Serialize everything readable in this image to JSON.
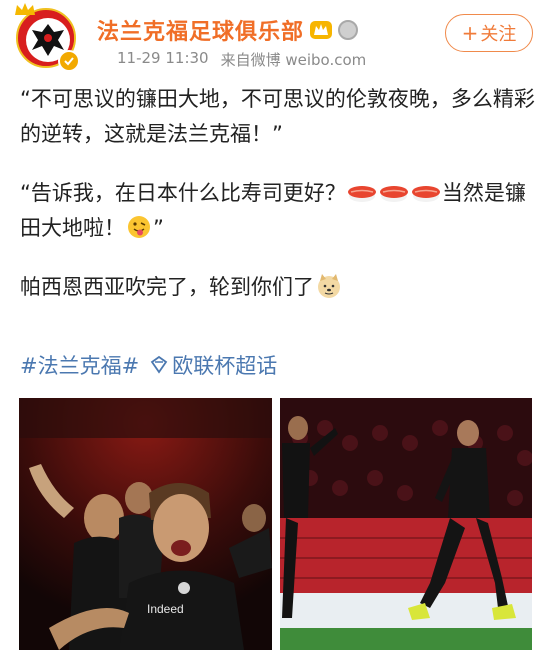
{
  "user": {
    "name": "法兰克福足球俱乐部",
    "time": "11-29 11:30",
    "source": "来自微博 weibo.com"
  },
  "follow_button": {
    "label": "关注"
  },
  "post": {
    "para1": "“不可思议的镰田大地，不可思议的伦敦夜晚，多么精彩的逆转，这就是法兰克福！”",
    "para2_before": "“告诉我，在日本什么比寿司更好？",
    "para2_mid": "当然是镰田大地啦！",
    "para2_end": "”",
    "para3": "帕西恩西亚吹完了，轮到你们了"
  },
  "tags": {
    "hashtag": "#法兰克福#",
    "super_topic": "欧联杯超话"
  },
  "photos": {
    "left_jersey_text": "Indeed"
  },
  "icons": [
    "crown-icon",
    "verified-icon",
    "vip-icon",
    "medal-icon",
    "plus-icon",
    "sushi-icon",
    "tongue-face-icon",
    "doge-icon",
    "super-topic-icon"
  ],
  "colors": {
    "username": "#f06e27",
    "link": "#4b78b0",
    "follow": "#f07b3a",
    "meta": "#8a8a8a"
  }
}
